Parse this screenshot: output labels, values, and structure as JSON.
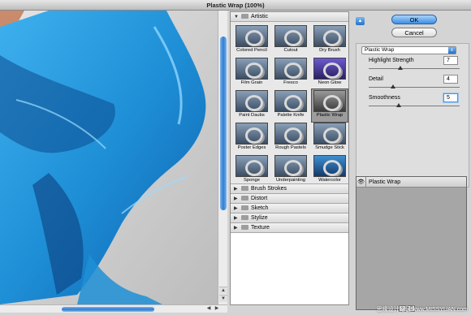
{
  "window": {
    "title": "Plastic Wrap (100%)"
  },
  "preview": {
    "zoom_label": "",
    "colors": {
      "fabric": "#1e8fd6",
      "fabric_dark": "#0b3f7e",
      "background": "#d6d6d6",
      "skin": "#c98b6c"
    }
  },
  "gallery": {
    "categories": [
      {
        "name": "Artistic",
        "expanded": true,
        "filters": [
          "Colored Pencil",
          "Cutout",
          "Dry Brush",
          "Film Grain",
          "Fresco",
          "Neon Glow",
          "Paint Daubs",
          "Palette Knife",
          "Plastic Wrap",
          "Poster Edges",
          "Rough Pastels",
          "Smudge Stick",
          "Sponge",
          "Underpainting",
          "Watercolor"
        ],
        "selected_filter": "Plastic Wrap"
      },
      {
        "name": "Brush Strokes",
        "expanded": false
      },
      {
        "name": "Distort",
        "expanded": false
      },
      {
        "name": "Sketch",
        "expanded": false
      },
      {
        "name": "Stylize",
        "expanded": false
      },
      {
        "name": "Texture",
        "expanded": false
      }
    ]
  },
  "controls": {
    "ok_label": "OK",
    "cancel_label": "Cancel",
    "filter_select": "Plastic Wrap",
    "params": [
      {
        "label": "Highlight Strength",
        "value": "7",
        "fraction": 0.35
      },
      {
        "label": "Detail",
        "value": "4",
        "fraction": 0.27
      },
      {
        "label": "Smoothness",
        "value": "5",
        "fraction": 0.33
      }
    ]
  },
  "layers": {
    "items": [
      "Plastic Wrap"
    ]
  },
  "watermark": "思缘设计论坛  www.MISSYUAN.com"
}
